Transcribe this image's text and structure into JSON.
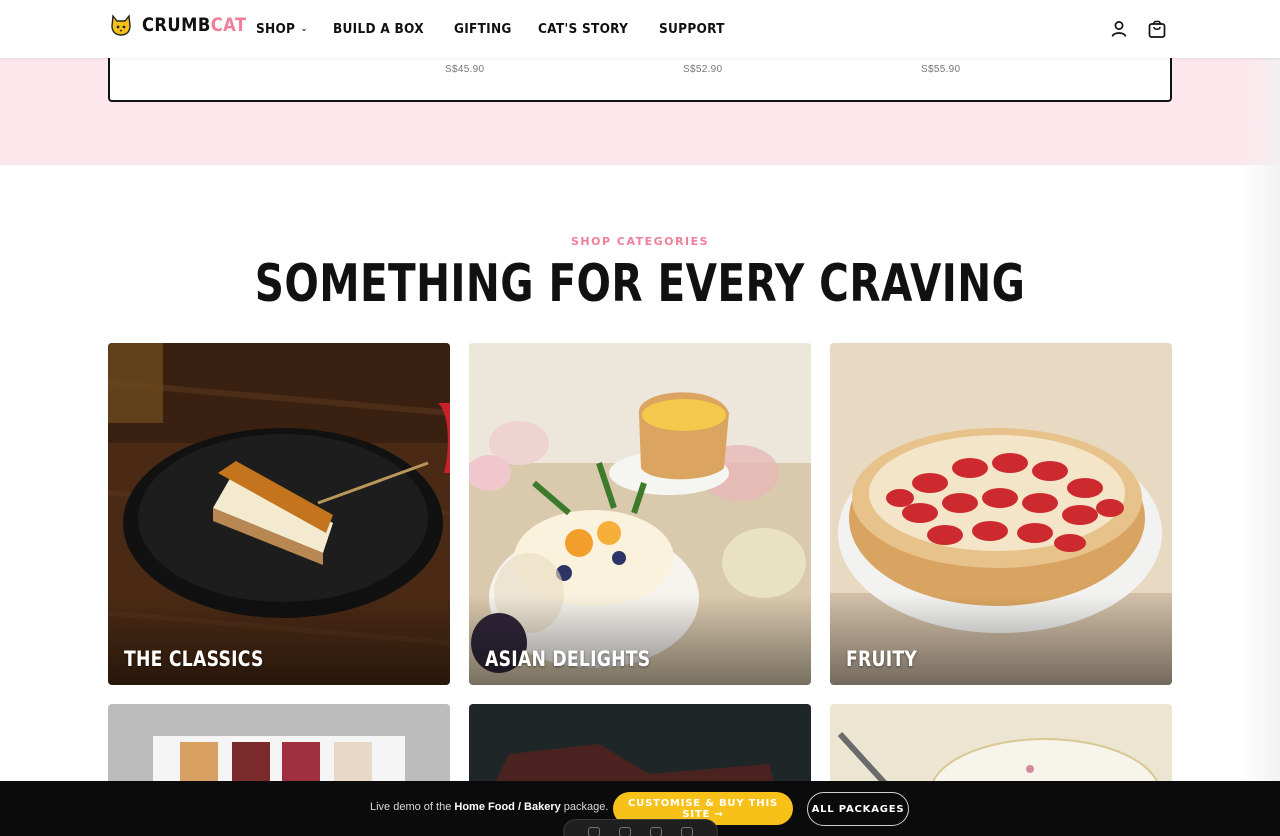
{
  "brand": {
    "name_part1": "CRUMB",
    "name_part2": "CAT",
    "accent_color": "#ef7f9a",
    "logo_icon": "cat-face-icon"
  },
  "nav": {
    "items": [
      {
        "label": "SHOP",
        "has_dropdown": true
      },
      {
        "label": "BUILD A BOX"
      },
      {
        "label": "GIFTING"
      },
      {
        "label": "CAT'S STORY"
      },
      {
        "label": "SUPPORT"
      }
    ],
    "account_icon": "user-icon",
    "cart_icon": "shopping-bag-icon"
  },
  "product_strip": {
    "prices": [
      "S$45.90",
      "S$52.90",
      "S$55.90"
    ]
  },
  "section": {
    "eyebrow": "SHOP CATEGORIES",
    "title": "SOMETHING FOR EVERY CRAVING"
  },
  "categories": [
    {
      "label": "THE CLASSICS"
    },
    {
      "label": "ASIAN DELIGHTS"
    },
    {
      "label": "FRUITY"
    }
  ],
  "demo_bar": {
    "text_before": "Live demo of the ",
    "package_name": "Home Food / Bakery",
    "text_after": " package.",
    "primary_button": "CUSTOMISE & BUY THIS SITE →",
    "secondary_button": "ALL PACKAGES",
    "primary_color": "#f7c11a"
  }
}
